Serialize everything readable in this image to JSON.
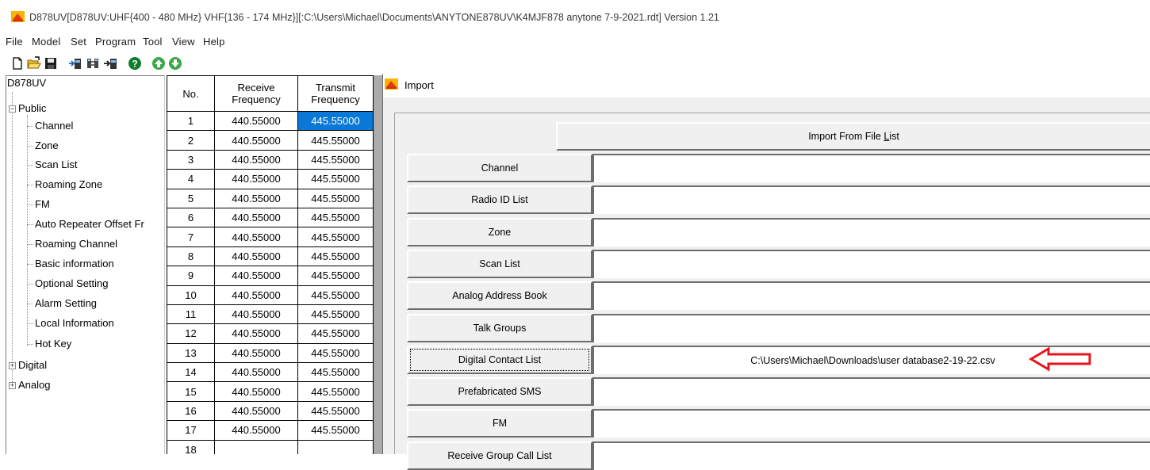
{
  "window": {
    "title": "D878UV[D878UV:UHF{400 - 480 MHz} VHF{136 - 174 MHz}][:C:\\Users\\Michael\\Documents\\ANYTONE878UV\\K4MJF878 anytone 7-9-2021.rdt] Version 1.21"
  },
  "menu": [
    "File",
    "Model",
    "Set",
    "Program",
    "Tool",
    "View",
    "Help"
  ],
  "toolbar": {
    "icons": [
      "new-file-icon",
      "open-folder-icon",
      "save-icon",
      "read-from-radio-icon",
      "radio-settings-icon",
      "write-to-radio-icon",
      "help-icon",
      "move-up-icon",
      "move-down-icon"
    ]
  },
  "tree": {
    "root": "D878UV",
    "public": "Public",
    "public_children": [
      "Channel",
      "Zone",
      "Scan List",
      "Roaming Zone",
      "FM",
      "Auto Repeater Offset Fr",
      "Roaming Channel",
      "Basic information",
      "Optional Setting",
      "Alarm Setting",
      "Local Information",
      "Hot Key"
    ],
    "digital": "Digital",
    "analog": "Analog"
  },
  "channel_table": {
    "headers": {
      "no": "No.",
      "rx": "Receive Frequency",
      "tx": "Transmit Frequency"
    },
    "rows": [
      {
        "no": "1",
        "rx": "440.55000",
        "tx": "445.55000"
      },
      {
        "no": "2",
        "rx": "440.55000",
        "tx": "445.55000"
      },
      {
        "no": "3",
        "rx": "440.55000",
        "tx": "445.55000"
      },
      {
        "no": "4",
        "rx": "440.55000",
        "tx": "445.55000"
      },
      {
        "no": "5",
        "rx": "440.55000",
        "tx": "445.55000"
      },
      {
        "no": "6",
        "rx": "440.55000",
        "tx": "445.55000"
      },
      {
        "no": "7",
        "rx": "440.55000",
        "tx": "445.55000"
      },
      {
        "no": "8",
        "rx": "440.55000",
        "tx": "445.55000"
      },
      {
        "no": "9",
        "rx": "440.55000",
        "tx": "445.55000"
      },
      {
        "no": "10",
        "rx": "440.55000",
        "tx": "445.55000"
      },
      {
        "no": "11",
        "rx": "440.55000",
        "tx": "445.55000"
      },
      {
        "no": "12",
        "rx": "440.55000",
        "tx": "445.55000"
      },
      {
        "no": "13",
        "rx": "440.55000",
        "tx": "445.55000"
      },
      {
        "no": "14",
        "rx": "440.55000",
        "tx": "445.55000"
      },
      {
        "no": "15",
        "rx": "440.55000",
        "tx": "445.55000"
      },
      {
        "no": "16",
        "rx": "440.55000",
        "tx": "445.55000"
      },
      {
        "no": "17",
        "rx": "440.55000",
        "tx": "445.55000"
      },
      {
        "no": "18",
        "rx": "",
        "tx": ""
      }
    ],
    "selected_cell": "1-tx"
  },
  "import_dialog": {
    "title": "Import",
    "import_from_file_list": {
      "label": "Import From File List",
      "accel": "L"
    },
    "items": [
      {
        "label": "Channel",
        "path": ""
      },
      {
        "label": "Radio ID List",
        "path": ""
      },
      {
        "label": "Zone",
        "path": ""
      },
      {
        "label": "Scan List",
        "path": ""
      },
      {
        "label": "Analog Address Book",
        "path": ""
      },
      {
        "label": "Talk Groups",
        "path": ""
      },
      {
        "label": "Digital Contact List",
        "path": "C:\\Users\\Michael\\Downloads\\user database2-19-22.csv"
      },
      {
        "label": "Prefabricated SMS",
        "path": ""
      },
      {
        "label": "FM",
        "path": ""
      },
      {
        "label": "Receive Group Call List",
        "path": ""
      }
    ],
    "focused_item": "Digital Contact List"
  },
  "colors": {
    "selection": "#0a78d7",
    "annotation_arrow": "#e8141b",
    "dialog_bg": "#f0f0f0"
  }
}
